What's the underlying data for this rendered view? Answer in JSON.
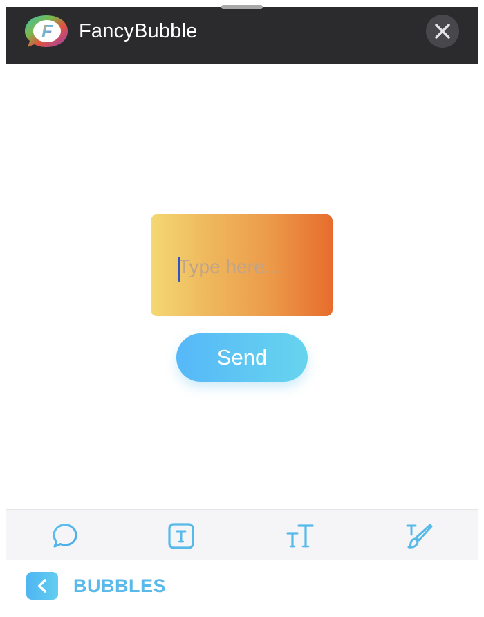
{
  "header": {
    "app_name": "FancyBubble",
    "logo_letter": "F"
  },
  "composer": {
    "placeholder": "Type here...",
    "value": "",
    "send_label": "Send"
  },
  "toolbar": {
    "tools": [
      {
        "icon": "speech-bubble-icon"
      },
      {
        "icon": "text-box-icon"
      },
      {
        "icon": "text-size-icon"
      },
      {
        "icon": "paint-brush-icon"
      }
    ]
  },
  "bottom_bar": {
    "section_label": "BUBBLES"
  },
  "colors": {
    "header_bg": "#2b2b2d",
    "accent_blue": "#58b9ea",
    "bubble_gradient_start": "#f4d872",
    "bubble_gradient_end": "#e76c2d",
    "send_gradient_start": "#56b8f8",
    "send_gradient_end": "#67d4ee"
  }
}
